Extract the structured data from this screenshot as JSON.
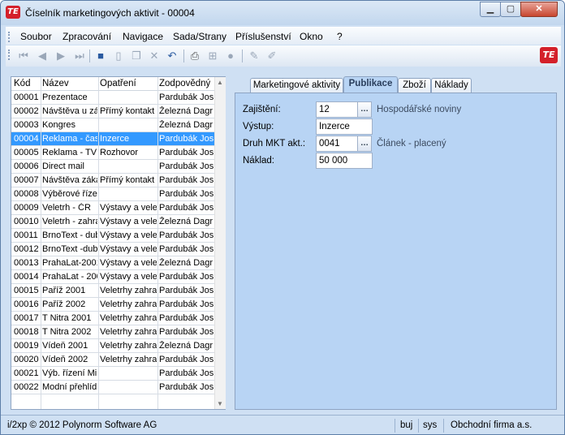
{
  "window": {
    "title": "Číselník marketingových aktivit - 00004",
    "app_logo": "TE"
  },
  "menu": [
    "Soubor",
    "Zpracování",
    "Navigace",
    "Sada/Strany",
    "Příslušenství",
    "Okno",
    "?"
  ],
  "toolbar": {
    "icons": [
      "first-record-icon",
      "prev-record-icon",
      "next-record-icon",
      "last-record-icon",
      "save-icon",
      "new-icon",
      "copy-icon",
      "delete-icon",
      "undo-icon",
      "print-icon",
      "tree-icon",
      "stop-icon",
      "edit-icon",
      "clear-icon"
    ],
    "brand_logo": "TE"
  },
  "grid": {
    "columns": [
      "Kód",
      "Název",
      "Opatření",
      "Zodpovědný"
    ],
    "rows": [
      {
        "kod": "00001",
        "nazev": "Prezentace",
        "opatreni": "",
        "zodpovedny": "Pardubák Jos"
      },
      {
        "kod": "00002",
        "nazev": "Návštěva u zá",
        "opatreni": "Přímý kontakt",
        "zodpovedny": "Železná Dagr"
      },
      {
        "kod": "00003",
        "nazev": "Kongres",
        "opatreni": "",
        "zodpovedny": "Železná Dagr"
      },
      {
        "kod": "00004",
        "nazev": "Reklama - čas",
        "opatreni": "Inzerce",
        "zodpovedny": "Pardubák Jos",
        "selected": true
      },
      {
        "kod": "00005",
        "nazev": "Reklama - TV",
        "opatreni": "Rozhovor",
        "zodpovedny": "Pardubák Jos"
      },
      {
        "kod": "00006",
        "nazev": "Direct mail",
        "opatreni": "",
        "zodpovedny": "Pardubák Jos"
      },
      {
        "kod": "00007",
        "nazev": "Návštěva záká",
        "opatreni": "Přímý kontakt",
        "zodpovedny": "Pardubák Jos"
      },
      {
        "kod": "00008",
        "nazev": "Výběrové řízer",
        "opatreni": "",
        "zodpovedny": "Pardubák Jos"
      },
      {
        "kod": "00009",
        "nazev": "Veletrh - ČR",
        "opatreni": "Výstavy a vele",
        "zodpovedny": "Pardubák Jos"
      },
      {
        "kod": "00010",
        "nazev": "Veletrh - zahra",
        "opatreni": "Výstavy a vele",
        "zodpovedny": "Železná Dagr"
      },
      {
        "kod": "00011",
        "nazev": "BrnoText - dub",
        "opatreni": "Výstavy a vele",
        "zodpovedny": "Pardubák Jos"
      },
      {
        "kod": "00012",
        "nazev": "BrnoText -dub",
        "opatreni": "Výstavy a vele",
        "zodpovedny": "Pardubák Jos"
      },
      {
        "kod": "00013",
        "nazev": "PrahaLat-2001",
        "opatreni": "Výstavy a vele",
        "zodpovedny": "Železná Dagr"
      },
      {
        "kod": "00014",
        "nazev": "PrahaLat - 200",
        "opatreni": "Výstavy a vele",
        "zodpovedny": "Pardubák Jos"
      },
      {
        "kod": "00015",
        "nazev": "Paříž 2001",
        "opatreni": "Veletrhy zahrar",
        "zodpovedny": "Pardubák Jos"
      },
      {
        "kod": "00016",
        "nazev": "Paříž 2002",
        "opatreni": "Veletrhy zahrar",
        "zodpovedny": "Pardubák Jos"
      },
      {
        "kod": "00017",
        "nazev": "T Nitra 2001",
        "opatreni": "Veletrhy zahrar",
        "zodpovedny": "Pardubák Jos"
      },
      {
        "kod": "00018",
        "nazev": "T Nitra 2002",
        "opatreni": "Veletrhy zahrar",
        "zodpovedny": "Pardubák Jos"
      },
      {
        "kod": "00019",
        "nazev": "Vídeň 2001",
        "opatreni": "Veletrhy zahrar",
        "zodpovedny": "Železná Dagr"
      },
      {
        "kod": "00020",
        "nazev": "Vídeň 2002",
        "opatreni": "Veletrhy zahrar",
        "zodpovedny": "Pardubák Jos"
      },
      {
        "kod": "00021",
        "nazev": "Výb. řízení Mir",
        "opatreni": "",
        "zodpovedny": "Pardubák Jos"
      },
      {
        "kod": "00022",
        "nazev": "Modní přehlídl",
        "opatreni": "",
        "zodpovedny": "Pardubák Jos"
      }
    ]
  },
  "tabs": [
    "Marketingové aktivity",
    "Publikace",
    "Zboží",
    "Náklady"
  ],
  "active_tab": "Publikace",
  "form": {
    "zajisteni": {
      "label": "Zajištění:",
      "value": "12",
      "desc": "Hospodářské noviny"
    },
    "vystup": {
      "label": "Výstup:",
      "value": "Inzerce"
    },
    "druh": {
      "label": "Druh MKT akt.:",
      "value": "0041",
      "desc": "Článek - placený"
    },
    "naklad": {
      "label": "Náklad:",
      "value": "50 000"
    }
  },
  "status": {
    "copyright": "i/2xp © 2012 Polynorm Software AG",
    "buj": "buj",
    "sys": "sys",
    "firm": "Obchodní firma a.s."
  },
  "colors": {
    "selection": "#3399ff",
    "panel": "#b8d4f4",
    "close_button": "#c8462f",
    "brand": "#d4202a"
  }
}
